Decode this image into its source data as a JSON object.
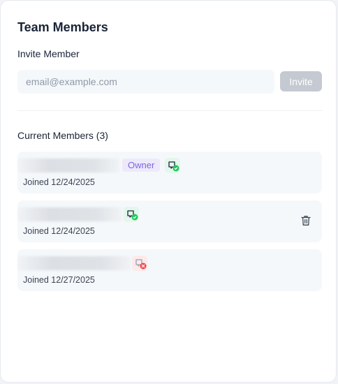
{
  "panel": {
    "title": "Team Members",
    "invite_heading": "Invite Member",
    "email_placeholder": "email@example.com",
    "email_value": "",
    "invite_button": "Invite",
    "members_heading": "Current Members (3)"
  },
  "members": [
    {
      "badge": "Owner",
      "joined": "Joined 12/24/2025",
      "github_status": "connected",
      "can_remove": false
    },
    {
      "badge": "",
      "joined": "Joined 12/24/2025",
      "github_status": "connected",
      "can_remove": true
    },
    {
      "badge": "",
      "joined": "Joined 12/27/2025",
      "github_status": "disconnected",
      "can_remove": false
    }
  ],
  "colors": {
    "owner_badge_bg": "#ede9fb",
    "owner_badge_text": "#7c68e0",
    "connected": "#22c55e",
    "disconnected": "#ef4444",
    "invite_disabled": "#c5c9d1"
  },
  "icons": {
    "connected": "github-connected-icon",
    "disconnected": "github-disconnected-icon",
    "remove": "trash-icon"
  }
}
